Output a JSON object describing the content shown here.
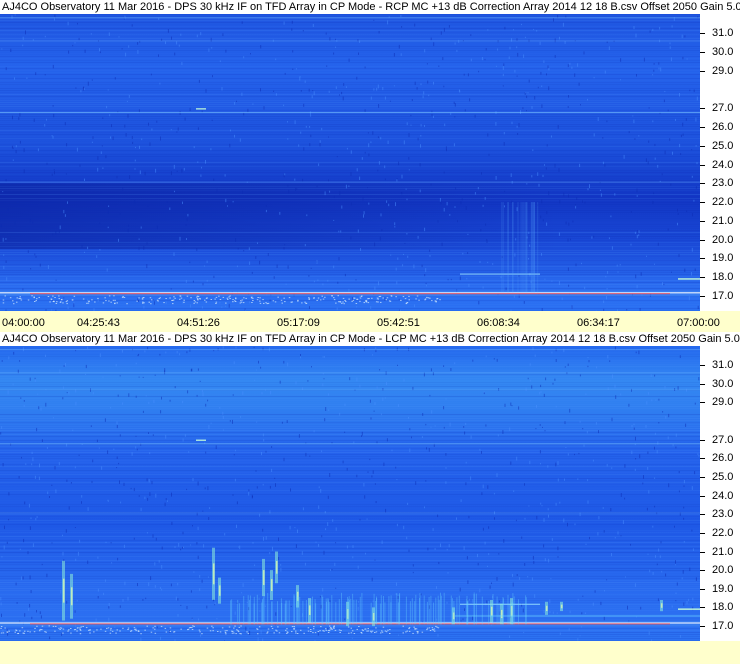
{
  "panels": [
    {
      "id": "rcp",
      "title": "AJ4CO Observatory 11 Mar 2016 - DPS 30 kHz IF on TFD Array in CP Mode - RCP  MC +13 dB  Correction Array 2014 12 18 B.csv  Offset 2050  Gain 5.0"
    },
    {
      "id": "lcp",
      "title": "AJ4CO Observatory 11 Mar 2016 - DPS 30 kHz IF on TFD Array in CP Mode - LCP  MC +13 dB  Correction Array 2014 12 18 B.csv  Offset 2050  Gain 5.0"
    }
  ],
  "chart_data": {
    "type": "heatmap",
    "x_ticks": [
      "04:00:00",
      "04:25:43",
      "04:51:26",
      "05:17:09",
      "05:42:51",
      "06:08:34",
      "06:34:17",
      "07:00:00"
    ],
    "y_ticks": [
      "31.0",
      "30.0",
      "29.0",
      "27.0",
      "26.0",
      "25.0",
      "24.0",
      "23.0",
      "22.0",
      "21.0",
      "20.0",
      "19.0",
      "18.0",
      "17.0"
    ],
    "colors": {
      "base": "#1e56e6",
      "dark": "#0f2db8",
      "light": "#3a8cf2",
      "bright": "#4fb8ff",
      "burst": "#9fe8ff",
      "red_line": "#ff3a3a",
      "axis_bg": "#ffffcc"
    }
  }
}
